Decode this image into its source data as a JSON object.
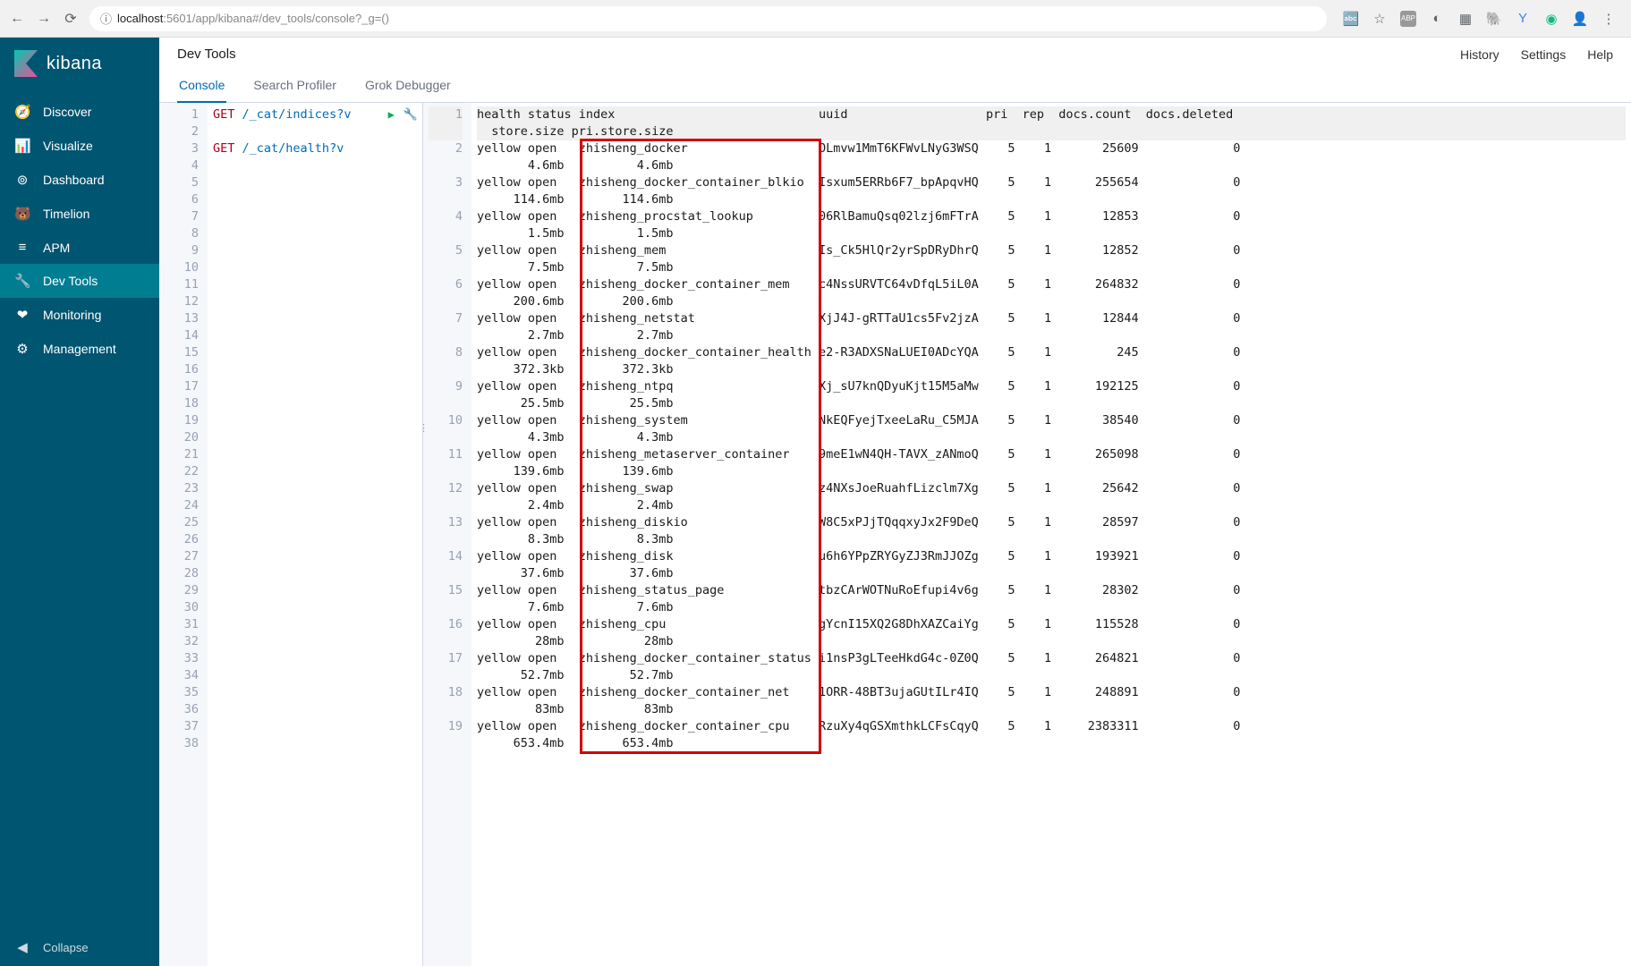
{
  "browser": {
    "url_prefix": "ⓘ ",
    "url_host": "localhost",
    "url_port": ":5601",
    "url_path": "/app/kibana#/dev_tools/console?_g=()"
  },
  "sidebar": {
    "logo_text": "kibana",
    "items": [
      {
        "icon": "🧭",
        "label": "Discover"
      },
      {
        "icon": "📊",
        "label": "Visualize"
      },
      {
        "icon": "⊚",
        "label": "Dashboard"
      },
      {
        "icon": "🐻",
        "label": "Timelion"
      },
      {
        "icon": "≡",
        "label": "APM"
      },
      {
        "icon": "🔧",
        "label": "Dev Tools"
      },
      {
        "icon": "❤",
        "label": "Monitoring"
      },
      {
        "icon": "⚙",
        "label": "Management"
      }
    ],
    "collapse": "Collapse"
  },
  "header": {
    "title": "Dev Tools",
    "links": [
      "History",
      "Settings",
      "Help"
    ]
  },
  "tabs": [
    "Console",
    "Search Profiler",
    "Grok Debugger"
  ],
  "request": {
    "lines": [
      {
        "n": 1,
        "method": "GET",
        "path": "/_cat/indices?v"
      },
      {
        "n": 2,
        "blank": true
      },
      {
        "n": 3,
        "method": "GET",
        "path": "/_cat/health?v"
      },
      {
        "n": 4,
        "blank": true
      },
      {
        "n": 5,
        "blank": true
      },
      {
        "n": 6,
        "blank": true
      },
      {
        "n": 7,
        "blank": true
      },
      {
        "n": 8,
        "blank": true
      },
      {
        "n": 9,
        "blank": true
      },
      {
        "n": 10,
        "blank": true
      },
      {
        "n": 11,
        "blank": true
      },
      {
        "n": 12,
        "blank": true
      },
      {
        "n": 13,
        "blank": true
      },
      {
        "n": 14,
        "blank": true
      },
      {
        "n": 15,
        "blank": true
      },
      {
        "n": 16,
        "blank": true
      },
      {
        "n": 17,
        "blank": true
      },
      {
        "n": 18,
        "blank": true
      },
      {
        "n": 19,
        "blank": true
      },
      {
        "n": 20,
        "blank": true
      },
      {
        "n": 21,
        "blank": true
      },
      {
        "n": 22,
        "blank": true
      },
      {
        "n": 23,
        "blank": true
      },
      {
        "n": 24,
        "blank": true
      },
      {
        "n": 25,
        "blank": true
      },
      {
        "n": 26,
        "blank": true
      },
      {
        "n": 27,
        "blank": true
      },
      {
        "n": 28,
        "blank": true
      },
      {
        "n": 29,
        "blank": true
      },
      {
        "n": 30,
        "blank": true
      },
      {
        "n": 31,
        "blank": true
      },
      {
        "n": 32,
        "blank": true
      },
      {
        "n": 33,
        "blank": true
      },
      {
        "n": 34,
        "blank": true
      },
      {
        "n": 35,
        "blank": true
      },
      {
        "n": 36,
        "blank": true
      },
      {
        "n": 37,
        "blank": true
      },
      {
        "n": 38,
        "blank": true
      }
    ]
  },
  "response": {
    "header": "health status index                            uuid                   pri  rep  docs.count  docs.deleted  store.size pri.store.size",
    "rows": [
      {
        "n": 2,
        "health": "yellow",
        "status": "open",
        "index": "zhisheng_docker",
        "uuid": "OLmvw1MmT6KFWvLNyG3WSQ",
        "pri": "5",
        "rep": "1",
        "count": "25609",
        "del": "0",
        "size": "4.6mb",
        "psize": "4.6mb"
      },
      {
        "n": 3,
        "health": "yellow",
        "status": "open",
        "index": "zhisheng_docker_container_blkio",
        "uuid": "Isxum5ERRb6F7_bpApqvHQ",
        "pri": "5",
        "rep": "1",
        "count": "255654",
        "del": "0",
        "size": "114.6mb",
        "psize": "114.6mb"
      },
      {
        "n": 4,
        "health": "yellow",
        "status": "open",
        "index": "zhisheng_procstat_lookup",
        "uuid": "06RlBamuQsq02lzj6mFTrA",
        "pri": "5",
        "rep": "1",
        "count": "12853",
        "del": "0",
        "size": "1.5mb",
        "psize": "1.5mb"
      },
      {
        "n": 5,
        "health": "yellow",
        "status": "open",
        "index": "zhisheng_mem",
        "uuid": "Is_Ck5HlQr2yrSpDRyDhrQ",
        "pri": "5",
        "rep": "1",
        "count": "12852",
        "del": "0",
        "size": "7.5mb",
        "psize": "7.5mb"
      },
      {
        "n": 6,
        "health": "yellow",
        "status": "open",
        "index": "zhisheng_docker_container_mem",
        "uuid": "c4NssURVTC64vDfqL5iL0A",
        "pri": "5",
        "rep": "1",
        "count": "264832",
        "del": "0",
        "size": "200.6mb",
        "psize": "200.6mb"
      },
      {
        "n": 7,
        "health": "yellow",
        "status": "open",
        "index": "zhisheng_netstat",
        "uuid": "XjJ4J-gRTTaU1cs5Fv2jzA",
        "pri": "5",
        "rep": "1",
        "count": "12844",
        "del": "0",
        "size": "2.7mb",
        "psize": "2.7mb"
      },
      {
        "n": 8,
        "health": "yellow",
        "status": "open",
        "index": "zhisheng_docker_container_health",
        "uuid": "e2-R3ADXSNaLUEI0ADcYQA",
        "pri": "5",
        "rep": "1",
        "count": "245",
        "del": "0",
        "size": "372.3kb",
        "psize": "372.3kb"
      },
      {
        "n": 9,
        "health": "yellow",
        "status": "open",
        "index": "zhisheng_ntpq",
        "uuid": "Xj_sU7knQDyuKjt15M5aMw",
        "pri": "5",
        "rep": "1",
        "count": "192125",
        "del": "0",
        "size": "25.5mb",
        "psize": "25.5mb"
      },
      {
        "n": 10,
        "health": "yellow",
        "status": "open",
        "index": "zhisheng_system",
        "uuid": "NkEQFyejTxeeLaRu_C5MJA",
        "pri": "5",
        "rep": "1",
        "count": "38540",
        "del": "0",
        "size": "4.3mb",
        "psize": "4.3mb"
      },
      {
        "n": 11,
        "health": "yellow",
        "status": "open",
        "index": "zhisheng_metaserver_container",
        "uuid": "9meE1wN4QH-TAVX_zANmoQ",
        "pri": "5",
        "rep": "1",
        "count": "265098",
        "del": "0",
        "size": "139.6mb",
        "psize": "139.6mb"
      },
      {
        "n": 12,
        "health": "yellow",
        "status": "open",
        "index": "zhisheng_swap",
        "uuid": "z4NXsJoeRuahfLizclm7Xg",
        "pri": "5",
        "rep": "1",
        "count": "25642",
        "del": "0",
        "size": "2.4mb",
        "psize": "2.4mb"
      },
      {
        "n": 13,
        "health": "yellow",
        "status": "open",
        "index": "zhisheng_diskio",
        "uuid": "W8C5xPJjTQqqxyJx2F9DeQ",
        "pri": "5",
        "rep": "1",
        "count": "28597",
        "del": "0",
        "size": "8.3mb",
        "psize": "8.3mb"
      },
      {
        "n": 14,
        "health": "yellow",
        "status": "open",
        "index": "zhisheng_disk",
        "uuid": "u6h6YPpZRYGyZJ3RmJJOZg",
        "pri": "5",
        "rep": "1",
        "count": "193921",
        "del": "0",
        "size": "37.6mb",
        "psize": "37.6mb"
      },
      {
        "n": 15,
        "health": "yellow",
        "status": "open",
        "index": "zhisheng_status_page",
        "uuid": "tbzCArWOTNuRoEfupi4v6g",
        "pri": "5",
        "rep": "1",
        "count": "28302",
        "del": "0",
        "size": "7.6mb",
        "psize": "7.6mb"
      },
      {
        "n": 16,
        "health": "yellow",
        "status": "open",
        "index": "zhisheng_cpu",
        "uuid": "gYcnI15XQ2G8DhXAZCaiYg",
        "pri": "5",
        "rep": "1",
        "count": "115528",
        "del": "0",
        "size": "28mb",
        "psize": "28mb"
      },
      {
        "n": 17,
        "health": "yellow",
        "status": "open",
        "index": "zhisheng_docker_container_status",
        "uuid": "i1nsP3gLTeeHkdG4c-0Z0Q",
        "pri": "5",
        "rep": "1",
        "count": "264821",
        "del": "0",
        "size": "52.7mb",
        "psize": "52.7mb"
      },
      {
        "n": 18,
        "health": "yellow",
        "status": "open",
        "index": "zhisheng_docker_container_net",
        "uuid": "1ORR-48BT3ujaGUtILr4IQ",
        "pri": "5",
        "rep": "1",
        "count": "248891",
        "del": "0",
        "size": "83mb",
        "psize": "83mb"
      },
      {
        "n": 19,
        "health": "yellow",
        "status": "open",
        "index": "zhisheng_docker_container_cpu",
        "uuid": "RzuXy4qGSXmthkLCFsCqyQ",
        "pri": "5",
        "rep": "1",
        "count": "2383311",
        "del": "0",
        "size": "653.4mb",
        "psize": "653.4mb"
      }
    ]
  }
}
